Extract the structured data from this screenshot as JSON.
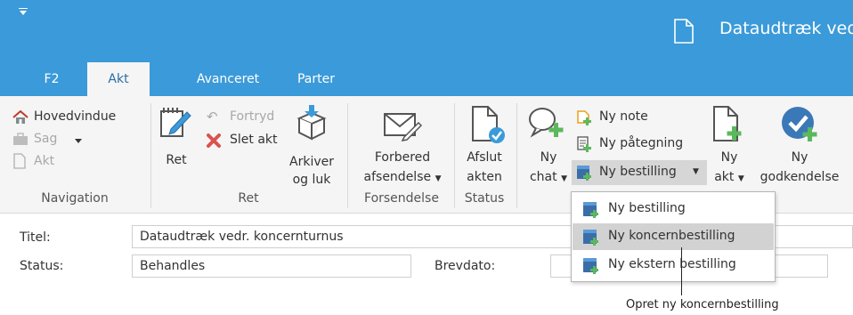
{
  "window": {
    "title": "Dataudtræk vedr"
  },
  "tabs": [
    {
      "label": "F2"
    },
    {
      "label": "Akt"
    },
    {
      "label": "Avanceret"
    },
    {
      "label": "Parter"
    }
  ],
  "ribbon": {
    "navigation": {
      "hovedvindue": "Hovedvindue",
      "sag": "Sag",
      "akt": "Akt",
      "group": "Navigation"
    },
    "ret": {
      "ret": "Ret",
      "fortryd": "Fortryd",
      "slet_akt": "Slet akt",
      "arkiver_1": "Arkiver",
      "arkiver_2": "og luk",
      "group": "Ret"
    },
    "forsendelse": {
      "line1": "Forbered",
      "line2": "afsendelse",
      "group": "Forsendelse"
    },
    "status": {
      "line1": "Afslut",
      "line2": "akten",
      "group": "Status"
    },
    "ny": {
      "chat_1": "Ny",
      "chat_2": "chat",
      "note": "Ny note",
      "paategning": "Ny påtegning",
      "bestilling": "Ny bestilling",
      "akt_1": "Ny",
      "akt_2": "akt",
      "godk_1": "Ny",
      "godk_2": "godkendelse"
    }
  },
  "dropdown": {
    "items": [
      {
        "label": "Ny bestilling"
      },
      {
        "label": "Ny koncernbestilling"
      },
      {
        "label": "Ny ekstern bestilling"
      }
    ]
  },
  "form": {
    "titel_label": "Titel:",
    "titel_value": "Dataudtræk vedr. koncernturnus",
    "status_label": "Status:",
    "status_value": "Behandles",
    "brevdato_label": "Brevdato:",
    "brevdato_value": ""
  },
  "callout": {
    "text": "Opret ny koncernbestilling"
  },
  "colors": {
    "accent": "#3b9ad9",
    "tab_active_text": "#2a6ea6",
    "ribbon_bg": "#f5f5f5",
    "delete_red": "#d9534f",
    "green_plus": "#5cb85c"
  }
}
